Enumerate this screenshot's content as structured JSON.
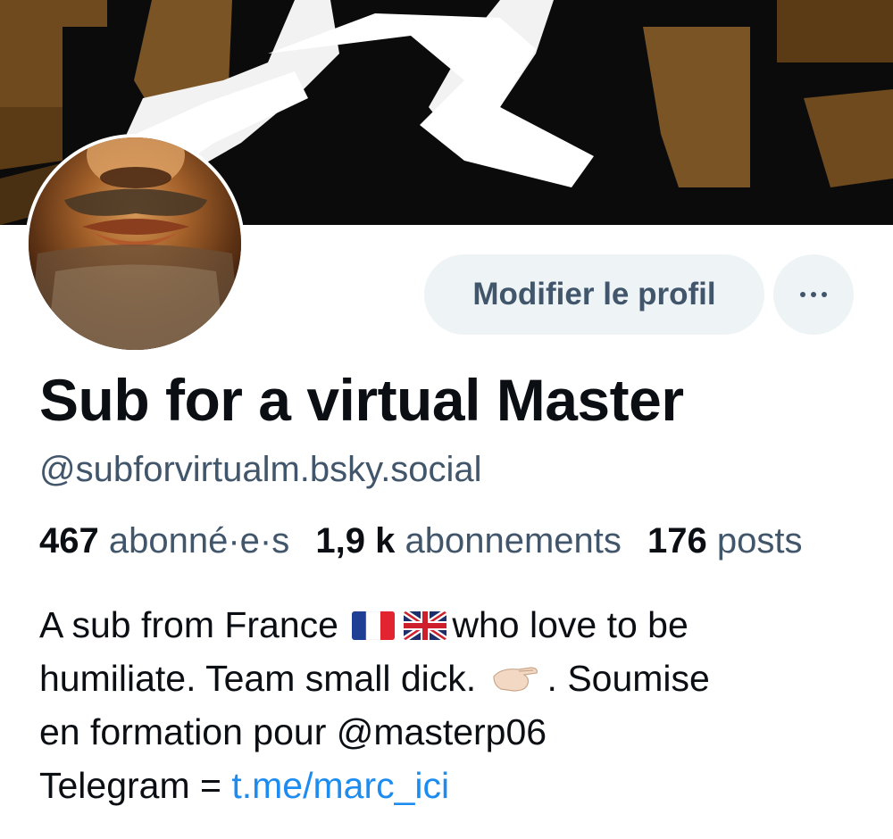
{
  "profile": {
    "display_name": "Sub for a virtual Master",
    "handle": "@subforvirtualm.bsky.social"
  },
  "actions": {
    "edit_label": "Modifier le profil",
    "more_icon": "ellipsis-icon"
  },
  "stats": {
    "followers_count": "467",
    "followers_label": "abonné·e·s",
    "following_count": "1,9 k",
    "following_label": "abonnements",
    "posts_count": "176",
    "posts_label": "posts"
  },
  "bio": {
    "line1_text": "A sub from France",
    "line1_flags": [
      "flag-france-icon",
      "flag-uk-icon"
    ],
    "line1_rest": "who love to be",
    "line2_text": "humiliate. Team small dick.",
    "line2_emoji": "pinching-hand-icon",
    "line2_rest": ". Soumise",
    "line3_text": "en formation pour @masterp06",
    "line4_prefix": "Telegram = ",
    "line4_link": "t.me/marc_ici"
  },
  "colors": {
    "secondary_text": "#42566b",
    "link": "#1d8cf0",
    "button_bg": "#eef3f6"
  }
}
